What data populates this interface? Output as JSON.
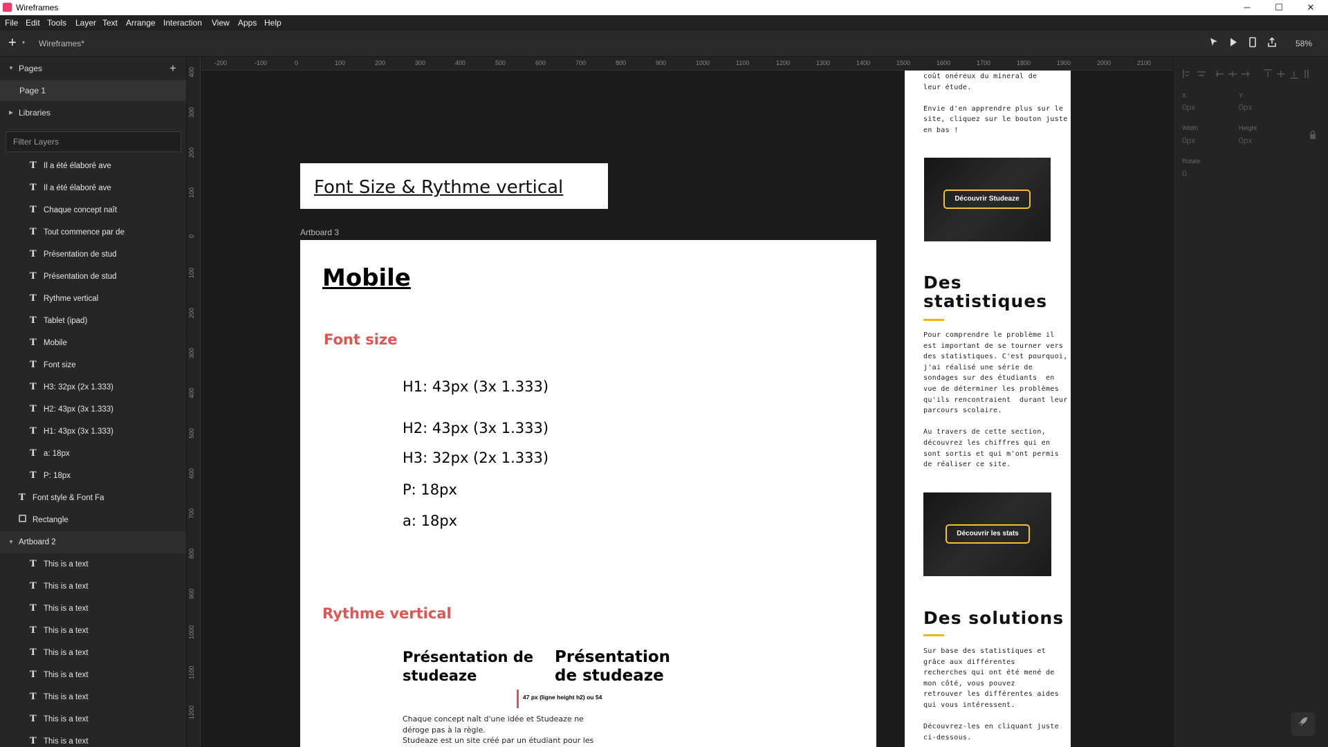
{
  "window": {
    "title": "Wireframes",
    "controls": [
      "─",
      "☐",
      "✕"
    ]
  },
  "menu": [
    "File",
    "Edit",
    "Tools",
    "Layer",
    "Text",
    "Arrange",
    "Interaction",
    "View",
    "Apps",
    "Help"
  ],
  "toolbar": {
    "add": "+",
    "caret": "▾",
    "document": "Wireframes*",
    "zoom": "58%"
  },
  "left_panel": {
    "pages_header": "Pages",
    "pages_add": "+",
    "page1": "Page 1",
    "libraries": "Libraries",
    "filter_placeholder": "Filter Layers",
    "layers": [
      "Il a été élaboré ave",
      "Il a été élaboré ave",
      "Chaque concept naît",
      "Tout commence par de",
      "Présentation de stud",
      "Présentation de stud",
      "Rythme vertical",
      "Tablet (ipad)",
      "Mobile",
      "Font size",
      "H3: 32px (2x 1.333)",
      "H2: 43px (3x 1.333)",
      "H1: 43px (3x 1.333)",
      "a: 18px",
      "P: 18px"
    ],
    "font_style": "Font style & Font Fa",
    "rectangle": "Rectangle",
    "artboard2": "Artboard 2",
    "artboard2_items": [
      "This is a text",
      "This is a text",
      "This is a text",
      "This is a text",
      "This is a text",
      "This is a text",
      "This is a text",
      "This is a text",
      "This is a text"
    ]
  },
  "rulers": {
    "h": [
      "-200",
      "-100",
      "0",
      "100",
      "200",
      "300",
      "400",
      "500",
      "600",
      "700",
      "800",
      "900",
      "1000",
      "1100",
      "1200",
      "1300",
      "1400",
      "1500",
      "1600",
      "1700",
      "1800",
      "1900",
      "2000",
      "2100"
    ],
    "v": [
      "400",
      "300",
      "200",
      "100",
      "0",
      "100",
      "200",
      "300",
      "400",
      "500",
      "600",
      "700",
      "800",
      "900",
      "1000",
      "1100",
      "1200"
    ]
  },
  "canvas": {
    "title_card": "Font Size & Rythme vertical",
    "artboard_label": "Artboard 3",
    "mobile_heading": "Mobile",
    "font_size_heading": "Font size",
    "h1": "H1: 43px (3x 1.333)",
    "h2": "H2: 43px (3x 1.333)",
    "h3": "H3: 32px (2x 1.333)",
    "p": "P: 18px",
    "a": "a: 18px",
    "rythme_heading": "Rythme vertical",
    "pres_left": "Présentation de\nstudeaze",
    "pres_right": "Présentation\nde studeaze",
    "line_height_note": "47 px (ligne height h2) ou 54",
    "body_text": "Chaque concept naît d'une idée et Studeaze ne\ndéroge pas à la règle.\nStudeaze est un site créé par un étudiant pour les"
  },
  "mobile_preview": {
    "top_text": "coût onéreux du mineral de\nleur étude.\n\nEnvie d'en apprendre plus sur le\nsite, cliquez sur le bouton juste\nen bas !",
    "btn1": "Découvrir Studeaze",
    "stats_heading": "Des\nstatistiques",
    "stats_text": "Pour comprendre le problème il\nest important de se tourner vers\ndes statistiques. C'est pourquoi,\nj'ai réalisé une série de\nsondages sur des étudiants  en\nvue de déterminer les problèmes\nqu'ils rencontraient  durant leur\nparcours scolaire.\n\nAu travers de cette section,\ndécouvrez les chiffres qui en\nsont sortis et qui m'ont permis\nde réaliser ce site.",
    "btn2": "Découvrir les stats",
    "solutions_heading": "Des solutions",
    "solutions_text": "Sur base des statistiques et\ngrâce aux différentes\nrecherches qui ont été mené de\nmon côté, vous pouvez\nretrouver les différentes aides\nqui vous intéressent.\n\nDécouvrez-les en cliquant juste\nci-dessous.",
    "accent": "#f2b411"
  },
  "right_panel": {
    "x_label": "X",
    "y_label": "Y",
    "x_val": "0px",
    "y_val": "0px",
    "w_label": "Width",
    "h_label": "Height",
    "w_val": "0px",
    "h_val": "0px",
    "rotate_label": "Rotate",
    "rotate_val": "0"
  },
  "colors": {
    "heading_red": "#e05454",
    "brand": "#f0396b"
  }
}
